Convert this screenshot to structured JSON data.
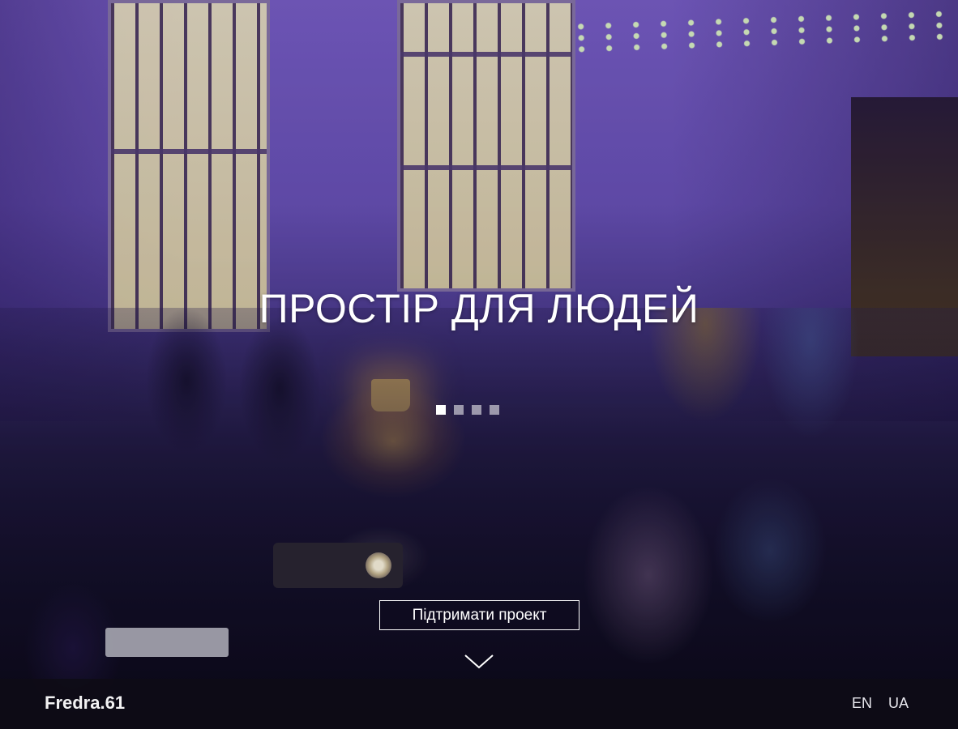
{
  "hero": {
    "headline": "ПРОСТІР ДЛЯ ЛЮДЕЙ",
    "slides": {
      "count": 4,
      "active_index": 0
    },
    "cta_label": "Підтримати проект",
    "scroll_icon": "chevron-down-icon"
  },
  "footer": {
    "brand": "Fredra.61",
    "languages": [
      "EN",
      "UA"
    ]
  },
  "colors": {
    "text": "#ffffff",
    "footer_bg": "#0e0c16",
    "photo_tint": "#6a52b8"
  }
}
